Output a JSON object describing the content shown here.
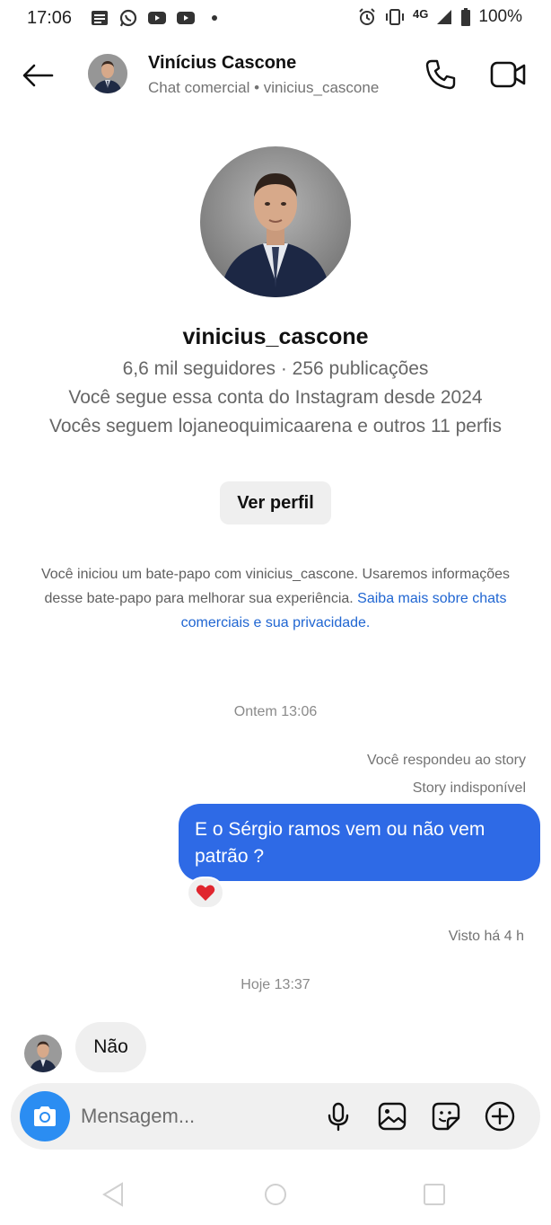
{
  "status_bar": {
    "time": "17:06",
    "network": "4G",
    "battery": "100%",
    "left_icons": [
      "news-icon",
      "whatsapp-icon",
      "youtube-icon",
      "youtube-icon",
      "dot-icon"
    ],
    "right_icons": [
      "alarm-icon",
      "vibrate-icon",
      "signal-icon",
      "battery-icon"
    ]
  },
  "header": {
    "name": "Vinícius Cascone",
    "subtitle": "Chat comercial • vinicius_cascone"
  },
  "profile": {
    "username": "vinicius_cascone",
    "stats": "6,6 mil seguidores · 256 publicações",
    "following_since": "Você segue essa conta do Instagram desde 2024",
    "mutuals": "Vocês seguem lojaneoquimicaarena e outros 11 perfis",
    "view_profile_button": "Ver perfil"
  },
  "disclaimer": {
    "text": "Você iniciou um bate-papo com vinicius_cascone. Usaremos informações desse bate-papo para melhorar sua experiência. ",
    "link": "Saiba mais sobre chats comerciais e sua privacidade."
  },
  "messages": {
    "timestamp_1": "Ontem 13:06",
    "reply_note": "Você respondeu ao story",
    "story_status": "Story indisponível",
    "outgoing_text": "E o Sérgio ramos vem ou não vem patrão ?",
    "reaction": "❤️",
    "seen": "Visto há 4 h",
    "timestamp_2": "Hoje 13:37",
    "incoming_text": "Não"
  },
  "composer": {
    "placeholder": "Mensagem..."
  },
  "colors": {
    "accent_blue": "#2e6ae6",
    "camera_blue": "#2b8df2",
    "link_blue": "#2066d2"
  }
}
